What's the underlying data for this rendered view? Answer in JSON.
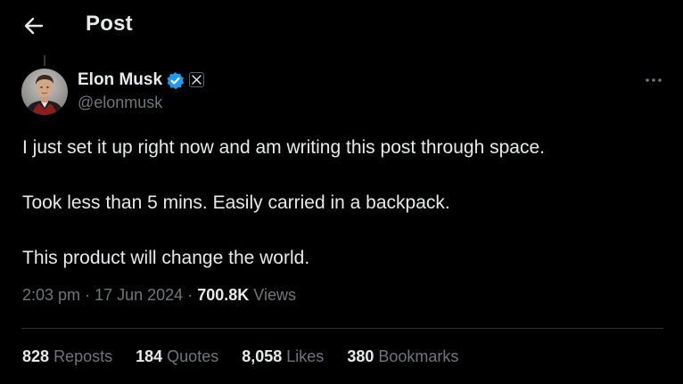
{
  "header": {
    "title": "Post",
    "back_icon": "arrow-left-icon"
  },
  "post": {
    "author": {
      "name": "Elon Musk",
      "handle": "@elonmusk",
      "verified_icon": "verified-badge-icon",
      "verified_color": "#1d9bf0",
      "affiliate_badge_text": "𝕏"
    },
    "more_icon": "more-horizontal-icon",
    "text": [
      "I just set it up right now and am writing this post through space.",
      "Took less than 5 mins. Easily carried in a backpack.",
      "This product will change the world."
    ],
    "meta": {
      "time": "2:03 pm",
      "sep1": "·",
      "date": "17 Jun 2024",
      "sep2": "·",
      "views_count": "700.8K",
      "views_label": "Views"
    },
    "stats": [
      {
        "count": "828",
        "label": "Reposts"
      },
      {
        "count": "184",
        "label": "Quotes"
      },
      {
        "count": "8,058",
        "label": "Likes"
      },
      {
        "count": "380",
        "label": "Bookmarks"
      }
    ]
  },
  "colors": {
    "background": "#000000",
    "text_primary": "#e7e9ea",
    "text_secondary": "#71767b",
    "divider": "#2f3336"
  }
}
